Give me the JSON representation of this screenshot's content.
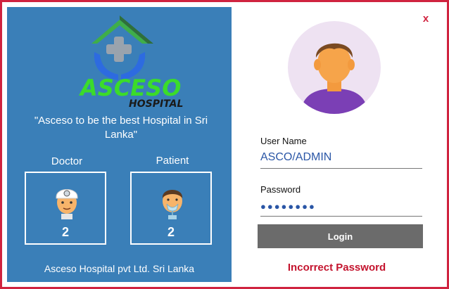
{
  "window": {
    "close_label": "x"
  },
  "brand": {
    "name": "ASCESO",
    "sub": "HOSPITAL",
    "tagline": "\"Asceso to be the best Hospital in Sri Lanka\"",
    "footer": "Asceso Hospital pvt Ltd. Sri Lanka"
  },
  "stats": [
    {
      "label": "Doctor",
      "count": "2",
      "icon": "doctor-icon"
    },
    {
      "label": "Patient",
      "count": "2",
      "icon": "patient-icon"
    }
  ],
  "login": {
    "avatar_icon": "user-avatar-icon",
    "username_label": "User Name",
    "username_value": "ASCO/ADMIN",
    "password_label": "Password",
    "password_value": "●●●●●●●●",
    "button_label": "Login",
    "error_message": "Incorrect Password"
  },
  "colors": {
    "panel_blue": "#3a7fb8",
    "border_red": "#d0233f",
    "logo_green": "#3bdc2a",
    "button_gray": "#6b6b6b",
    "error_red": "#c4142e"
  }
}
